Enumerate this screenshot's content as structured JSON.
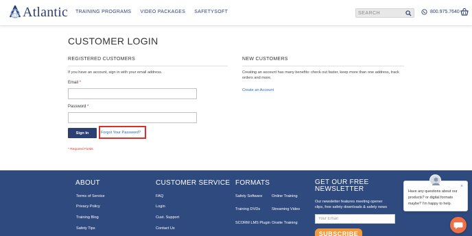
{
  "header": {
    "logo_text": "Atlantic",
    "nav": [
      "TRAINING PROGRAMS",
      "VIDEO PACKAGES",
      "SAFETYSOFT"
    ],
    "search_placeholder": "SEARCH",
    "phone": "800.975.7640"
  },
  "main": {
    "page_title": "CUSTOMER LOGIN",
    "registered": {
      "title": "REGISTERED CUSTOMERS",
      "intro": "If you have an account, sign in with your email address.",
      "email_label": "Email",
      "password_label": "Password",
      "required_mark": "*",
      "signin_label": "Sign In",
      "forgot_label": "Forgot Your Password?",
      "required_note": "* Required Fields"
    },
    "new_customers": {
      "title": "NEW CUSTOMERS",
      "text_line1": "Creating an account has many benefits: check out faster, keep more than one address, track",
      "text_line2": "orders and more.",
      "create_label": "Create an Account"
    }
  },
  "footer": {
    "about": {
      "title": "ABOUT",
      "links": [
        "Terms of Service",
        "Privacy Policy",
        "Training Blog",
        "Safety Tips"
      ]
    },
    "customer_service": {
      "title": "CUSTOMER SERVICE",
      "links": [
        "FAQ",
        "Login",
        "Cust. Support",
        "Contact Us"
      ]
    },
    "formats": {
      "title": "FORMATS",
      "col1": [
        "Safety Software",
        "Training DVDs",
        "SCORM LMS Plugin"
      ],
      "col2": [
        "Online Training",
        "Streaming Video",
        "Onsite Training"
      ]
    },
    "newsletter": {
      "title_line1": "GET OUR FREE",
      "title_line2": "NEWSLETTER",
      "desc_line1": "Our newsletter features meeting opener",
      "desc_line2": "clips, free safety downloads & safety news",
      "email_placeholder": "Your Email",
      "subscribe_label": "SUBSCRIBE"
    }
  },
  "chat": {
    "text": "Have any questions about our products? or digital formats maybe? I'm happy to help.",
    "close": "×"
  },
  "colors": {
    "brand_navy": "#2b3f73",
    "footer_bg": "#2e4a7e",
    "link_blue": "#2b6cb0",
    "required_red": "#e02b27",
    "subscribe_orange": "#f29a3c",
    "chat_orange": "#f06f45"
  },
  "icons": [
    "logo-globe-icon",
    "search-icon",
    "whatsapp-phone-icon",
    "cart-icon",
    "close-icon",
    "chat-icon"
  ]
}
